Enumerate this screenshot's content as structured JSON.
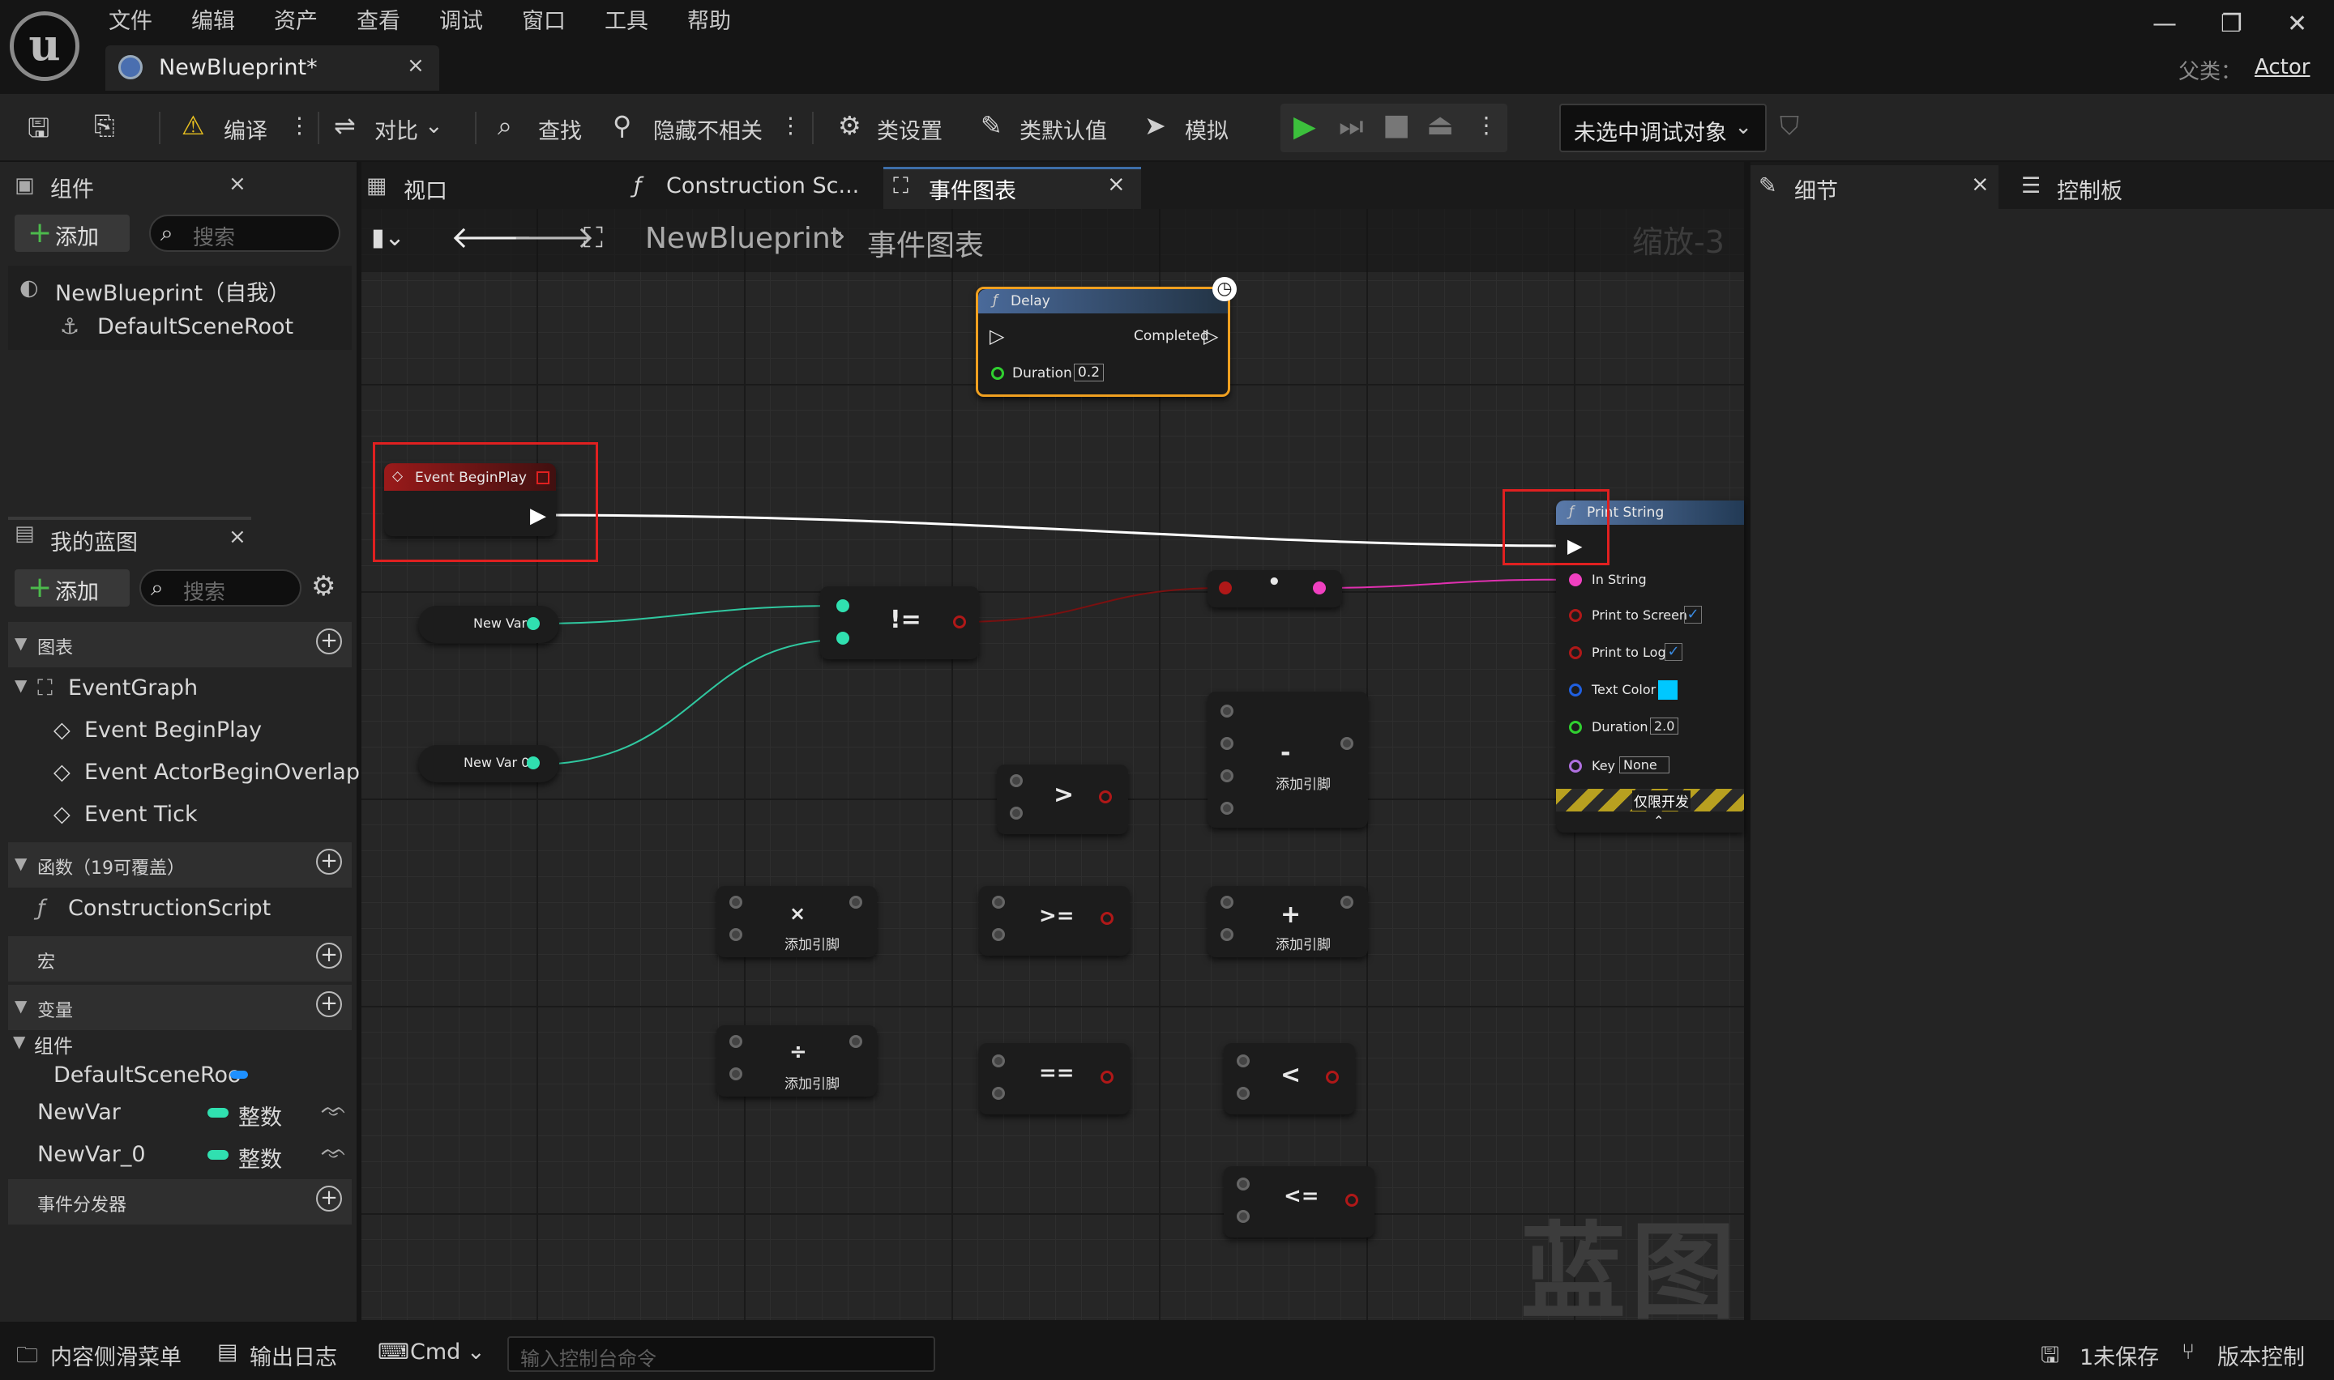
{
  "menu": [
    "文件",
    "编辑",
    "资产",
    "查看",
    "调试",
    "窗口",
    "工具",
    "帮助"
  ],
  "tab": {
    "title": "NewBlueprint*",
    "close": "×"
  },
  "window": {
    "minimize": "—",
    "restore": "❐",
    "close": "✕"
  },
  "parent": {
    "label": "父类：",
    "value": "Actor"
  },
  "toolbar": {
    "compile": "编译",
    "diff": "对比",
    "find": "查找",
    "hide_unrelated": "隐藏不相关",
    "class_settings": "类设置",
    "class_defaults": "类默认值",
    "simulate": "模拟",
    "debug_target": "未选中调试对象"
  },
  "components_panel": {
    "title": "组件",
    "add": "添加",
    "search_placeholder": "搜索",
    "items": [
      "NewBlueprint（自我）",
      "DefaultSceneRoot"
    ]
  },
  "my_blueprint": {
    "title": "我的蓝图",
    "add": "添加",
    "search_placeholder": "搜索",
    "graphs_section": "图表",
    "event_graph": "EventGraph",
    "events": [
      "Event BeginPlay",
      "Event ActorBeginOverlap",
      "Event Tick"
    ],
    "functions_section": "函数（19可覆盖）",
    "construction_script": "ConstructionScript",
    "macros_section": "宏",
    "variables_section": "变量",
    "components_group": "组件",
    "component_var": "DefaultSceneRoo",
    "vars": [
      {
        "name": "NewVar",
        "type": "整数"
      },
      {
        "name": "NewVar_0",
        "type": "整数"
      }
    ],
    "dispatchers_section": "事件分发器"
  },
  "center_tabs": [
    "视口",
    "Construction Sc...",
    "事件图表"
  ],
  "breadcrumb": {
    "root": "NewBlueprint",
    "sep": "›",
    "current": "事件图表"
  },
  "zoom_label": "缩放-3",
  "watermark": "蓝图",
  "nodes": {
    "delay": {
      "title": "Delay",
      "completed": "Completed",
      "duration_label": "Duration",
      "duration_value": "0.2"
    },
    "begin_play": {
      "title": "Event BeginPlay"
    },
    "print_string": {
      "title": "Print String",
      "in_string": "In String",
      "print_to_screen": "Print to Screen",
      "print_to_log": "Print to Log",
      "text_color": "Text Color",
      "duration_label": "Duration",
      "duration_value": "2.0",
      "key_label": "Key",
      "key_value": "None",
      "dev_only": "仅限开发"
    },
    "new_var": "New Var",
    "new_var_0": "New Var 0",
    "ops": {
      "neq": "!=",
      "gt": ">",
      "gte": ">=",
      "eq": "==",
      "lt": "<",
      "lte": "<=",
      "mul": "×",
      "div": "÷",
      "add": "+",
      "sub": "-",
      "dot": "•",
      "add_pin": "添加引脚"
    }
  },
  "right_tabs": [
    "细节",
    "控制板"
  ],
  "status": {
    "content_drawer": "内容侧滑菜单",
    "output_log": "输出日志",
    "cmd": "Cmd",
    "console_placeholder": "输入控制台命令",
    "unsaved": "1未保存",
    "source_control": "版本控制"
  },
  "colors": {
    "accent_orange": "#f0a020",
    "exec_white": "#ffffff",
    "int_teal": "#30e0b0",
    "string_pink": "#f040c0",
    "bool_red": "#b01818",
    "struct_blue": "#2060e0",
    "float_green": "#30d030",
    "name_purple": "#b070e0",
    "text_color_swatch": "#00c8ff"
  }
}
